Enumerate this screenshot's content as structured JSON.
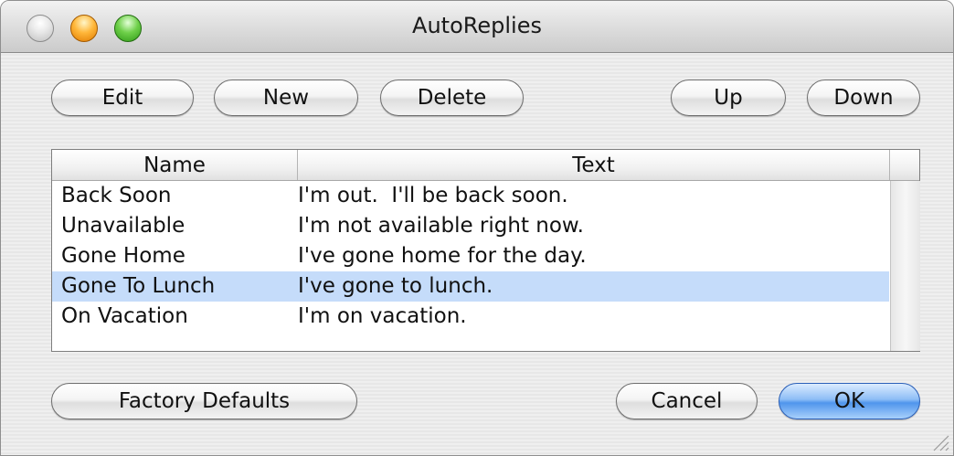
{
  "window": {
    "title": "AutoReplies"
  },
  "toolbar": {
    "edit_label": "Edit",
    "new_label": "New",
    "delete_label": "Delete",
    "up_label": "Up",
    "down_label": "Down"
  },
  "table": {
    "columns": {
      "name": "Name",
      "text": "Text"
    },
    "rows": [
      {
        "name": "Back Soon",
        "text": "I'm out.  I'll be back soon.",
        "selected": false
      },
      {
        "name": "Unavailable",
        "text": "I'm not available right now.",
        "selected": false
      },
      {
        "name": "Gone Home",
        "text": "I've gone home for the day.",
        "selected": false
      },
      {
        "name": "Gone To Lunch",
        "text": "I've gone to lunch.",
        "selected": true
      },
      {
        "name": "On Vacation",
        "text": "I'm on vacation.",
        "selected": false
      }
    ]
  },
  "footer": {
    "factory_defaults_label": "Factory Defaults",
    "cancel_label": "Cancel",
    "ok_label": "OK"
  },
  "icons": {
    "close": "close-icon",
    "minimize": "minimize-icon",
    "zoom": "zoom-icon",
    "resize": "resize-grip-icon"
  },
  "colors": {
    "selection": "#c5dcfa",
    "default_button": "#4f95ec"
  }
}
